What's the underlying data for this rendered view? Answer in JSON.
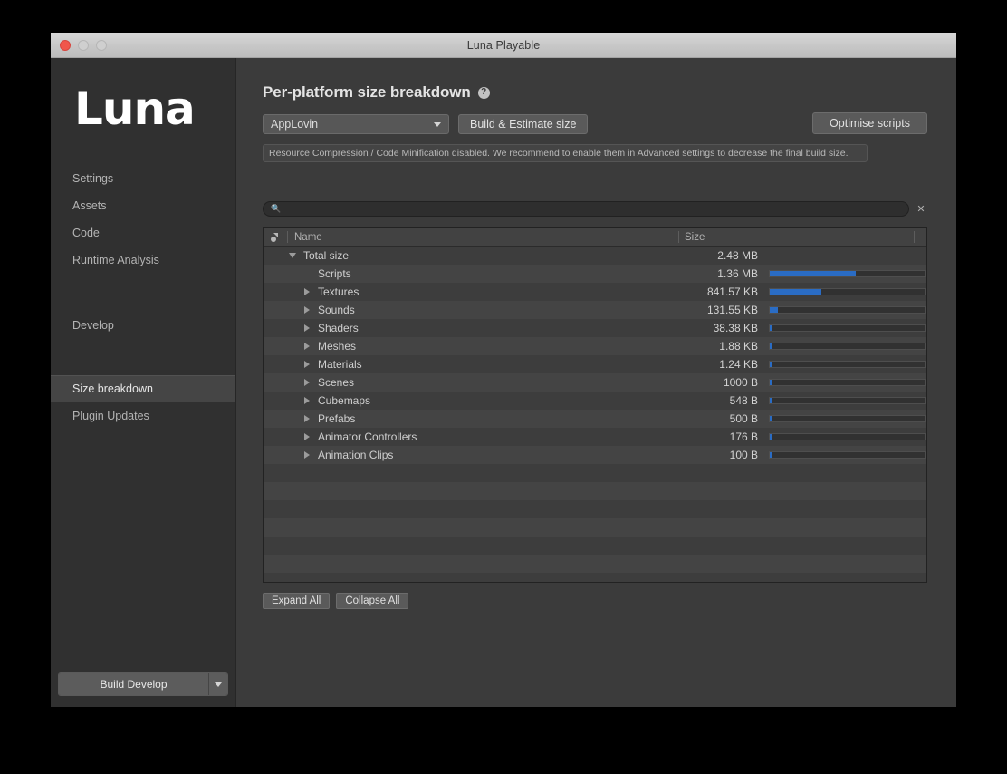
{
  "window": {
    "title": "Luna Playable",
    "traffic_lights": [
      "close",
      "minimize",
      "zoom"
    ]
  },
  "sidebar": {
    "logo": "Luna",
    "items": [
      {
        "label": "Settings",
        "selected": false
      },
      {
        "label": "Assets",
        "selected": false
      },
      {
        "label": "Code",
        "selected": false
      },
      {
        "label": "Runtime Analysis",
        "selected": false
      },
      {
        "label": "Develop",
        "selected": false
      },
      {
        "label": "Size breakdown",
        "selected": true
      },
      {
        "label": "Plugin Updates",
        "selected": false
      }
    ],
    "build_button": {
      "label": "Build Develop",
      "dropdown_icon": "chevron-down-icon"
    }
  },
  "main": {
    "page_title": "Per-platform size breakdown",
    "help_icon": "help-circle-icon",
    "platform_select": {
      "value": "AppLovin",
      "dropdown_icon": "chevron-down-icon"
    },
    "build_estimate_button": "Build & Estimate size",
    "optimise_button": "Optimise scripts",
    "warning": "Resource Compression / Code Minification disabled. We recommend to enable them in Advanced settings to decrease the final build size.",
    "search": {
      "icon": "search-icon",
      "value": "",
      "placeholder": "",
      "clear_icon": "close-icon"
    },
    "table": {
      "header_icon": "sort-filter-icon",
      "columns": [
        "Name",
        "Size"
      ],
      "rows": [
        {
          "name": "Total size",
          "size": "2.48 MB",
          "indent": 1,
          "twisty": "down",
          "bar": null
        },
        {
          "name": "Scripts",
          "size": "1.36 MB",
          "indent": 2,
          "twisty": "none",
          "bar": 55
        },
        {
          "name": "Textures",
          "size": "841.57 KB",
          "indent": 2,
          "twisty": "right",
          "bar": 33
        },
        {
          "name": "Sounds",
          "size": "131.55 KB",
          "indent": 2,
          "twisty": "right",
          "bar": 5.2
        },
        {
          "name": "Shaders",
          "size": "38.38 KB",
          "indent": 2,
          "twisty": "right",
          "bar": 1.5
        },
        {
          "name": "Meshes",
          "size": "1.88 KB",
          "indent": 2,
          "twisty": "right",
          "bar": 0.9
        },
        {
          "name": "Materials",
          "size": "1.24 KB",
          "indent": 2,
          "twisty": "right",
          "bar": 0.9
        },
        {
          "name": "Scenes",
          "size": "1000 B",
          "indent": 2,
          "twisty": "right",
          "bar": 0.9
        },
        {
          "name": "Cubemaps",
          "size": "548 B",
          "indent": 2,
          "twisty": "right",
          "bar": 0.9
        },
        {
          "name": "Prefabs",
          "size": "500 B",
          "indent": 2,
          "twisty": "right",
          "bar": 0.9
        },
        {
          "name": "Animator Controllers",
          "size": "176 B",
          "indent": 2,
          "twisty": "right",
          "bar": 0.9
        },
        {
          "name": "Animation Clips",
          "size": "100 B",
          "indent": 2,
          "twisty": "right",
          "bar": 0.9
        }
      ],
      "empty_row_count": 7
    },
    "expand_all_button": "Expand All",
    "collapse_all_button": "Collapse All"
  },
  "colors": {
    "accent_blue": "#2a6cc4",
    "window_bg": "#3b3b3b",
    "sidebar_bg": "#303030",
    "selected_item": "#454545"
  }
}
